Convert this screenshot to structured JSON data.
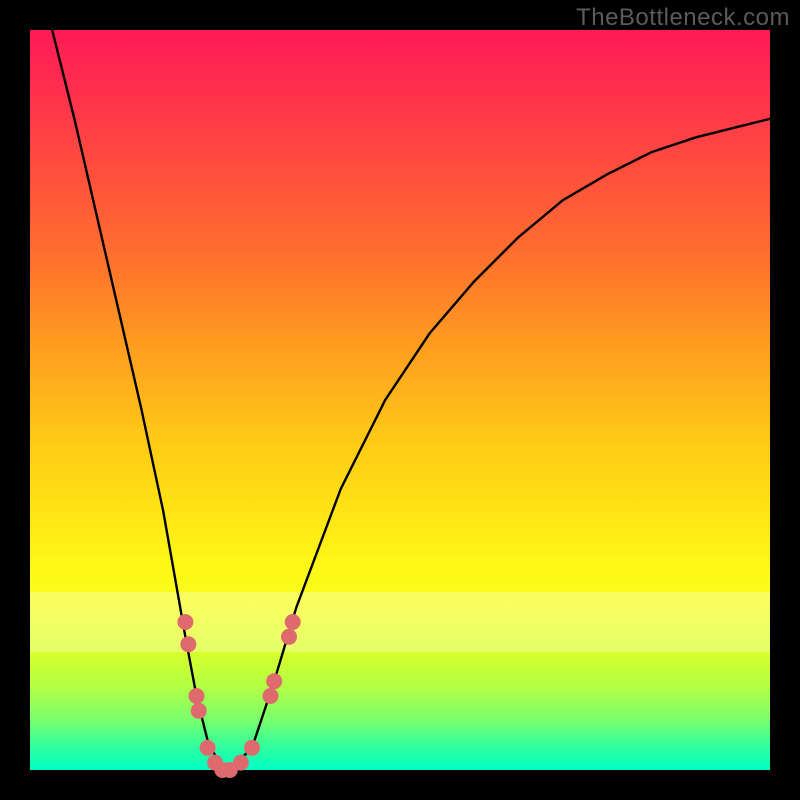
{
  "attribution": "TheBottleneck.com",
  "colors": {
    "frame": "#000000",
    "attribution_text": "#5b5b5b",
    "gradient_stops": [
      "#ff1a56",
      "#ff2f4e",
      "#ff4b3f",
      "#ff6e2e",
      "#ff9a20",
      "#ffc817",
      "#ffe414",
      "#fff617",
      "#f6ff1c",
      "#d8ff2a",
      "#b0ff46",
      "#7cff6a",
      "#2eff9e",
      "#00ffc8"
    ],
    "curve": "#000000",
    "markers": "#de6a6e",
    "overlay_stripe": "rgba(255,255,255,0.30)"
  },
  "chart_data": {
    "type": "line",
    "title": "",
    "xlabel": "",
    "ylabel": "",
    "xlim": [
      0,
      100
    ],
    "ylim": [
      0,
      100
    ],
    "grid": false,
    "legend": false,
    "series": [
      {
        "name": "bottleneck-curve",
        "x": [
          3,
          6,
          9,
          12,
          15,
          18,
          21,
          22.5,
          24,
          25.5,
          27,
          30,
          33,
          36,
          42,
          48,
          54,
          60,
          66,
          72,
          78,
          84,
          90,
          96,
          100
        ],
        "y": [
          100,
          88,
          75,
          62,
          49,
          35,
          18,
          10,
          4,
          1,
          0,
          3,
          12,
          22,
          38,
          50,
          59,
          66,
          72,
          77,
          80.5,
          83.5,
          85.5,
          87,
          88
        ]
      }
    ],
    "markers": {
      "series": "bottleneck-curve",
      "points": [
        {
          "x": 21.0,
          "y": 20
        },
        {
          "x": 21.4,
          "y": 17
        },
        {
          "x": 22.5,
          "y": 10
        },
        {
          "x": 22.8,
          "y": 8
        },
        {
          "x": 24.0,
          "y": 3
        },
        {
          "x": 25.0,
          "y": 1
        },
        {
          "x": 26.0,
          "y": 0
        },
        {
          "x": 27.0,
          "y": 0
        },
        {
          "x": 28.5,
          "y": 1
        },
        {
          "x": 30.0,
          "y": 3
        },
        {
          "x": 32.5,
          "y": 10
        },
        {
          "x": 33.0,
          "y": 12
        },
        {
          "x": 35.0,
          "y": 18
        },
        {
          "x": 35.5,
          "y": 20
        }
      ]
    },
    "overlay_band": {
      "y_from": 16,
      "y_to": 24
    }
  }
}
